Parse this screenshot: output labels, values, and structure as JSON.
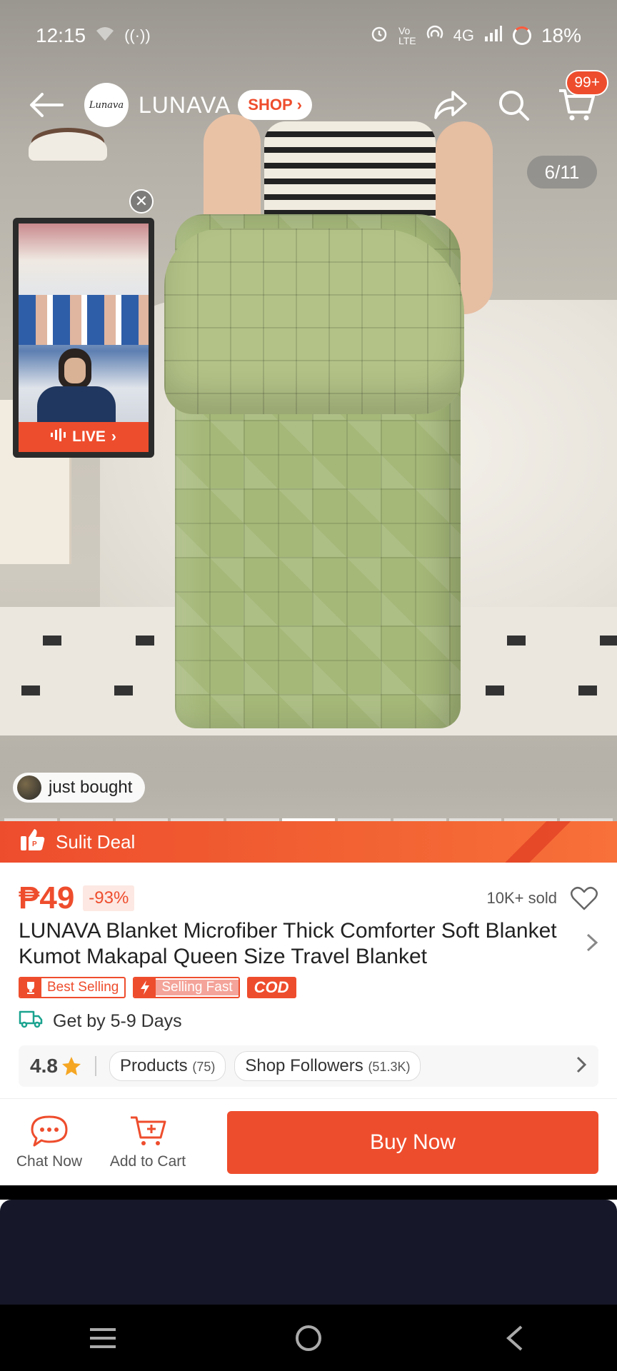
{
  "status_bar": {
    "time": "12:15",
    "network": "4G",
    "battery": "18%"
  },
  "header": {
    "shop_logo_text": "Lunava",
    "shop_name": "LUNAVA",
    "shop_tag": "SHOP",
    "cart_badge": "99+"
  },
  "gallery": {
    "counter": "6/11",
    "total_images": 11,
    "current_index": 6
  },
  "live": {
    "label": "LIVE"
  },
  "just_bought": {
    "label": "just bought"
  },
  "deal": {
    "label": "Sulit Deal"
  },
  "product": {
    "price": "₱49",
    "discount": "-93%",
    "sold": "10K+ sold",
    "title": "LUNAVA Blanket Microfiber Thick Comforter Soft Blanket Kumot Makapal Queen Size Travel Blanket",
    "badges": {
      "best_selling": "Best Selling",
      "selling_fast": "Selling Fast",
      "cod": "COD"
    },
    "delivery": "Get by 5-9 Days"
  },
  "shop_stats": {
    "rating": "4.8",
    "products_label": "Products",
    "products_count": "(75)",
    "followers_label": "Shop Followers",
    "followers_count": "(51.3K)"
  },
  "actions": {
    "chat_now": "Chat Now",
    "add_to_cart": "Add to Cart",
    "buy_now": "Buy Now"
  },
  "colors": {
    "accent": "#ee4d2d",
    "star": "#f5a623"
  }
}
